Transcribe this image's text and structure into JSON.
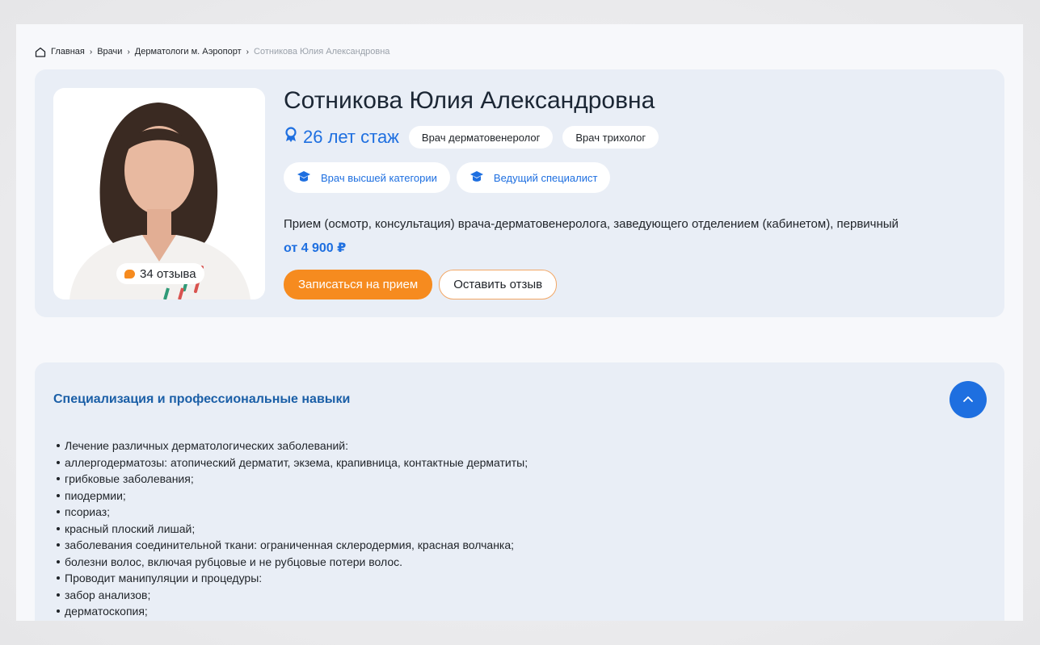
{
  "breadcrumb": {
    "items": [
      "Главная",
      "Врачи",
      "Дерматологи м. Аэропорт"
    ],
    "current": "Сотникова Юлия Александровна"
  },
  "doctor": {
    "name": "Сотникова Юлия Александровна",
    "experience": "26 лет стаж",
    "tags": [
      "Врач дерматовенеролог",
      "Врач трихолог"
    ],
    "categories": [
      "Врач высшей категории",
      "Ведущий специалист"
    ],
    "reviews": "34 отзыва",
    "service": "Прием (осмотр, консультация) врача-дерматовенеролога, заведующего отделением (кабинетом), первичный",
    "price": "от 4 900 ₽",
    "book_label": "Записаться на прием",
    "review_label": "Оставить отзыв"
  },
  "skills": {
    "title": "Специализация и профессиональные навыки",
    "items": [
      "Лечение различных дерматологических заболеваний:",
      "аллергодерматозы: атопический дерматит, экзема, крапивница, контактные дерматиты;",
      "грибковые заболевания;",
      "пиодермии;",
      "псориаз;",
      "красный плоский лишай;",
      "заболевания соединительной ткани: ограниченная склеродермия, красная волчанка;",
      "болезни волос, включая рубцовые и не рубцовые потери волос.",
      "Проводит манипуляции и процедуры:",
      "забор анализов;",
      "дерматоскопия;"
    ]
  },
  "colors": {
    "accent": "#1e6fe0",
    "orange": "#f68b1f",
    "card_bg": "#e9eef6",
    "title_blue": "#1b5fa7"
  },
  "icons": [
    "home-icon",
    "chevron-right-icon",
    "award-icon",
    "graduation-cap-icon",
    "chat-bubble-icon",
    "chevron-up-icon"
  ]
}
